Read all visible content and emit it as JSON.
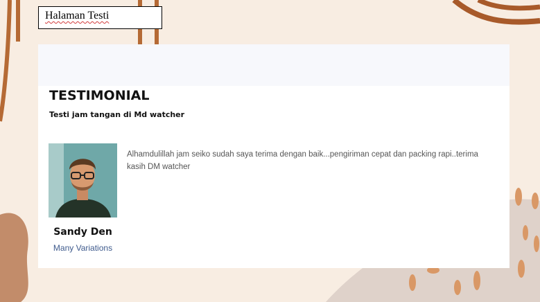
{
  "page": {
    "title": "Halaman Testi"
  },
  "section": {
    "heading": "TESTIMONIAL",
    "subheading": "Testi jam tangan di Md watcher"
  },
  "testimonial": {
    "quote": "Alhamdulillah jam seiko sudah saya terima dengan baik...pengiriman cepat dan packing rapi..terima kasih DM watcher",
    "name": "Sandy Den",
    "role": "Many Variations",
    "photo_icon": "person-avatar-icon"
  },
  "colors": {
    "background": "#f8ede2",
    "accent_brown": "#a85a2a",
    "role_text": "#3e5a8c"
  }
}
